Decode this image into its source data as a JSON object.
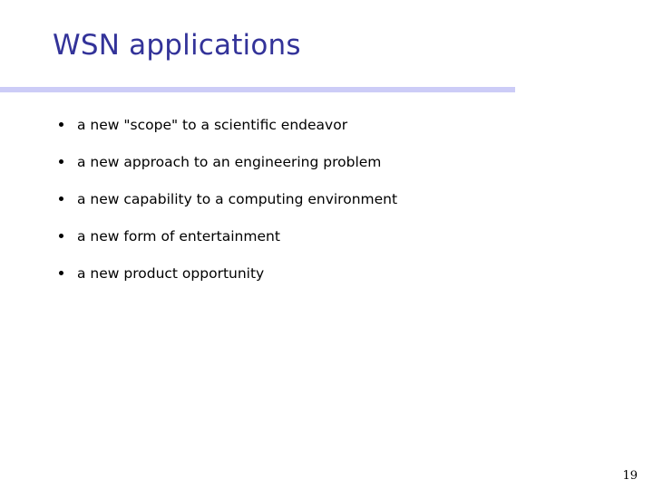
{
  "slide": {
    "title": "WSN applications",
    "title_color": "#333399",
    "rule_color": "#ccccf7",
    "background_color": "#ffffff",
    "body_text_color": "#000000",
    "bullets": [
      {
        "text": "a new \"scope\" to a scientific endeavor",
        "marker": "bullet-dot"
      },
      {
        "text": "a new approach to an engineering problem",
        "marker": "bullet-dot"
      },
      {
        "text": "a new capability to a computing environment",
        "marker": "bullet-dot"
      },
      {
        "text": "a new form of entertainment",
        "marker": "bullet-dot"
      },
      {
        "text": "a new product opportunity",
        "marker": "bullet-dot"
      }
    ],
    "page_number": "19"
  }
}
